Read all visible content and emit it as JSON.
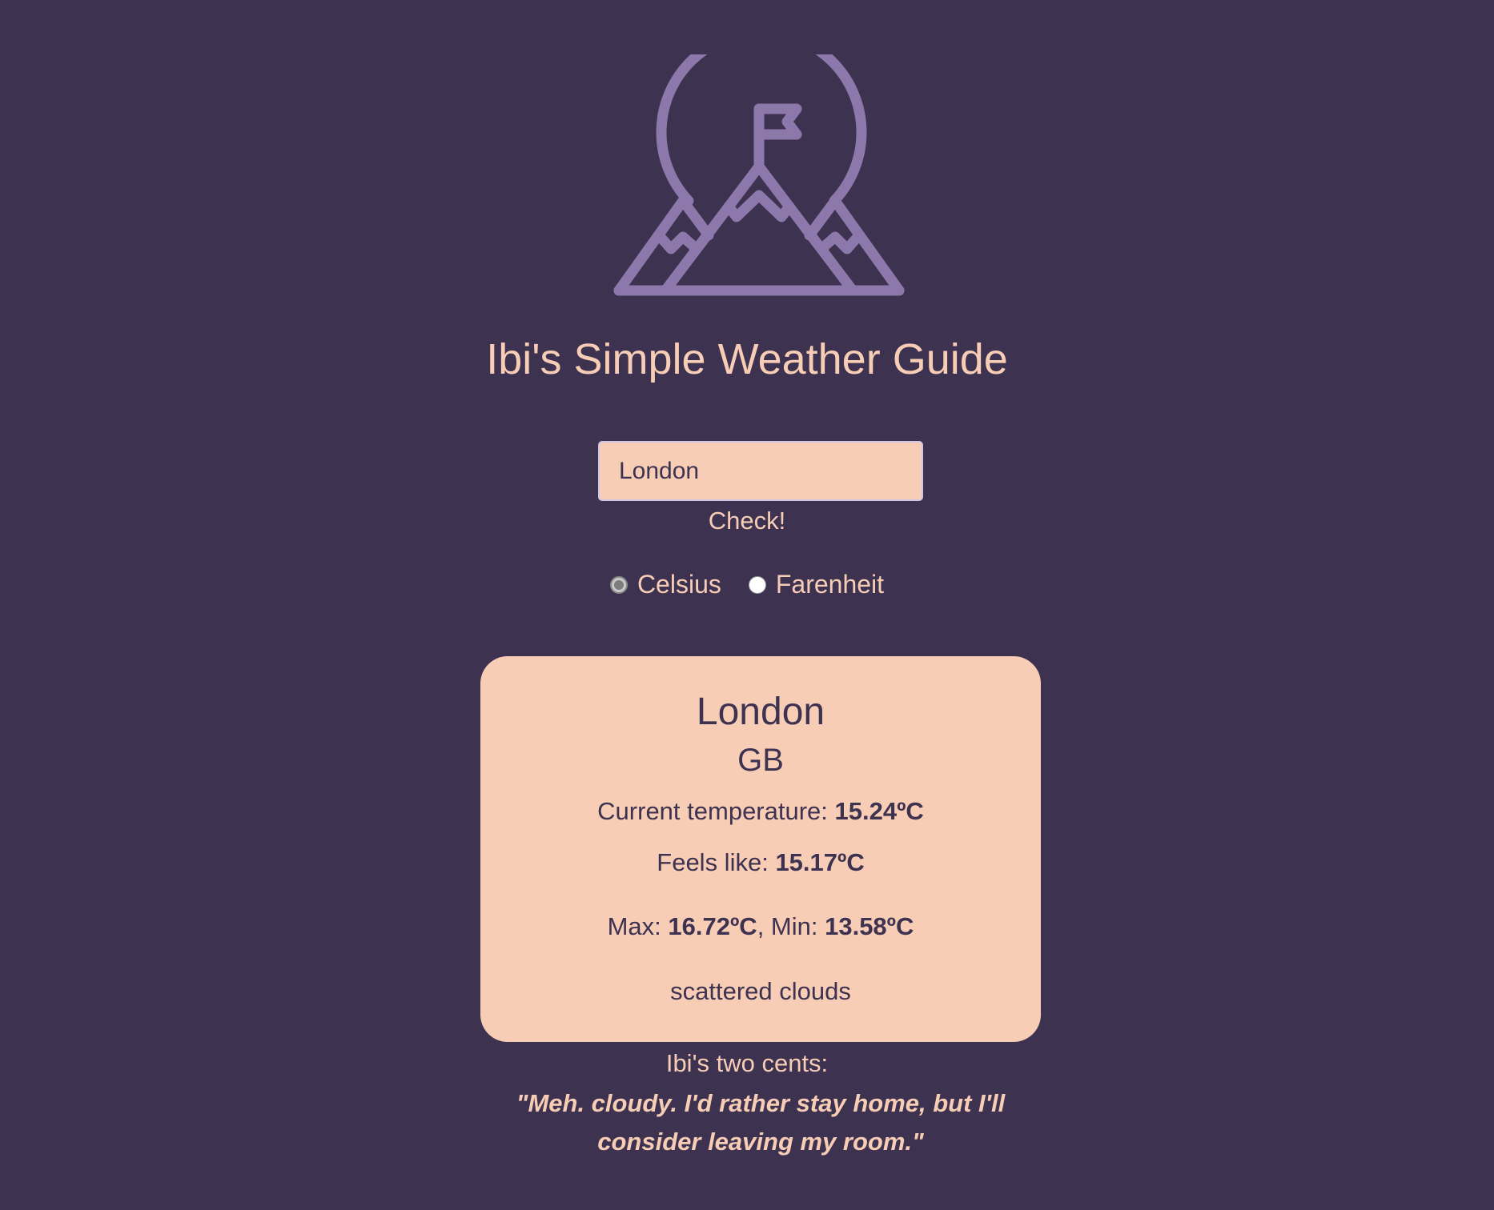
{
  "header": {
    "logo_icon": "mountain-flag-icon",
    "title": "Ibi's Simple Weather Guide"
  },
  "search": {
    "value": "London",
    "button_label": "Check!"
  },
  "units": {
    "options": [
      {
        "label": "Celsius",
        "selected": true
      },
      {
        "label": "Farenheit",
        "selected": false
      }
    ]
  },
  "weather": {
    "city": "London",
    "country": "GB",
    "current_label": "Current temperature: ",
    "current_value": "15.24ºC",
    "feels_label": "Feels like: ",
    "feels_value": "15.17ºC",
    "max_label": "Max: ",
    "max_value": "16.72ºC",
    "min_label": ", Min: ",
    "min_value": "13.58ºC",
    "description": "scattered clouds"
  },
  "advice": {
    "label": "Ibi's two cents:",
    "quote": "\"Meh. cloudy. I'd rather stay home, but I'll consider leaving my room.\""
  },
  "colors": {
    "background": "#3d3250",
    "accent": "#f8cdb6",
    "logo": "#8c78aa",
    "text_dark": "#3d3250"
  }
}
